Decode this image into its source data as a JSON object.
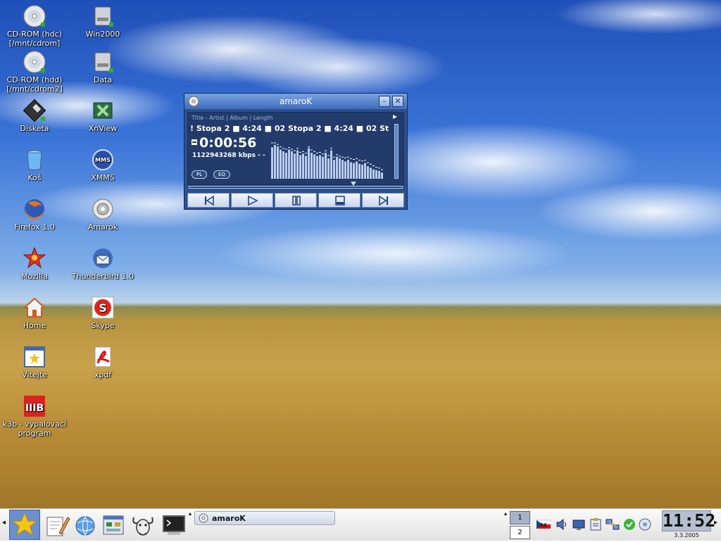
{
  "desktop": {
    "icons": [
      {
        "label": "CD-ROM (hdc)\n[/mnt/cdrom]",
        "icon": "cdrom-icon"
      },
      {
        "label": "Win2000",
        "icon": "harddisk-icon"
      },
      {
        "label": "CD-ROM (hdd)\n[/mnt/cdrom2]",
        "icon": "cdrom-icon"
      },
      {
        "label": "Data",
        "icon": "harddisk-icon"
      },
      {
        "label": "Disketa",
        "icon": "floppy-icon"
      },
      {
        "label": "XnView",
        "icon": "xnview-icon"
      },
      {
        "label": "Koš",
        "icon": "trash-icon"
      },
      {
        "label": "XMMS",
        "icon": "xmms-icon"
      },
      {
        "label": "Firefox 1.0",
        "icon": "firefox-icon"
      },
      {
        "label": "Amarok",
        "icon": "amarok-icon"
      },
      {
        "label": "Mozilla",
        "icon": "mozilla-icon"
      },
      {
        "label": "Thunderbird 1.0",
        "icon": "thunderbird-icon"
      },
      {
        "label": "Home",
        "icon": "home-icon"
      },
      {
        "label": "Skype",
        "icon": "skype-icon"
      },
      {
        "label": "Vítejte",
        "icon": "welcome-icon"
      },
      {
        "label": "xpdf",
        "icon": "pdf-icon"
      },
      {
        "label": "k3b - vypalovací\nprogram",
        "icon": "k3b-icon"
      }
    ]
  },
  "player": {
    "title": "amaroK",
    "columns": "Title - Artist | Album | Length",
    "scroll_text": "! Stopa 2  ■  4:24  ■  02 Stopa 2  ■  4:24  ■  02 Stopa 2",
    "time": "0:00:56",
    "bitrate": "1122943268 kbps - -",
    "pl_label": "PL",
    "eq_label": "EQ",
    "progress": 0.78,
    "analyzer": [
      0.8,
      0.86,
      0.82,
      0.74,
      0.7,
      0.66,
      0.74,
      0.7,
      0.64,
      0.72,
      0.6,
      0.64,
      0.58,
      0.78,
      0.66,
      0.62,
      0.58,
      0.6,
      0.56,
      0.66,
      0.52,
      0.72,
      0.48,
      0.56,
      0.52,
      0.48,
      0.44,
      0.48,
      0.42,
      0.4,
      0.44,
      0.38,
      0.36,
      0.4,
      0.32,
      0.28,
      0.24,
      0.22,
      0.2,
      0.16
    ],
    "peaks": [
      0.92,
      0.92,
      0.88,
      0.82,
      0.78,
      0.76,
      0.8,
      0.76,
      0.72,
      0.78,
      0.68,
      0.7,
      0.66,
      0.82,
      0.74,
      0.7,
      0.66,
      0.68,
      0.64,
      0.72,
      0.6,
      0.78,
      0.56,
      0.62,
      0.58,
      0.56,
      0.54,
      0.56,
      0.52,
      0.5,
      0.52,
      0.48,
      0.46,
      0.48,
      0.42,
      0.38,
      0.34,
      0.3,
      0.28,
      0.24
    ]
  },
  "taskbar": {
    "task_label": "amaroK",
    "pager": [
      "1",
      "2"
    ],
    "clock": "11:52",
    "date": "3.3.2005",
    "lang": "CZ"
  },
  "colors": {
    "window_title": "#3e6cbf",
    "player_bg": "#223b6b",
    "analyzer_bar": "#b9cdf0"
  }
}
